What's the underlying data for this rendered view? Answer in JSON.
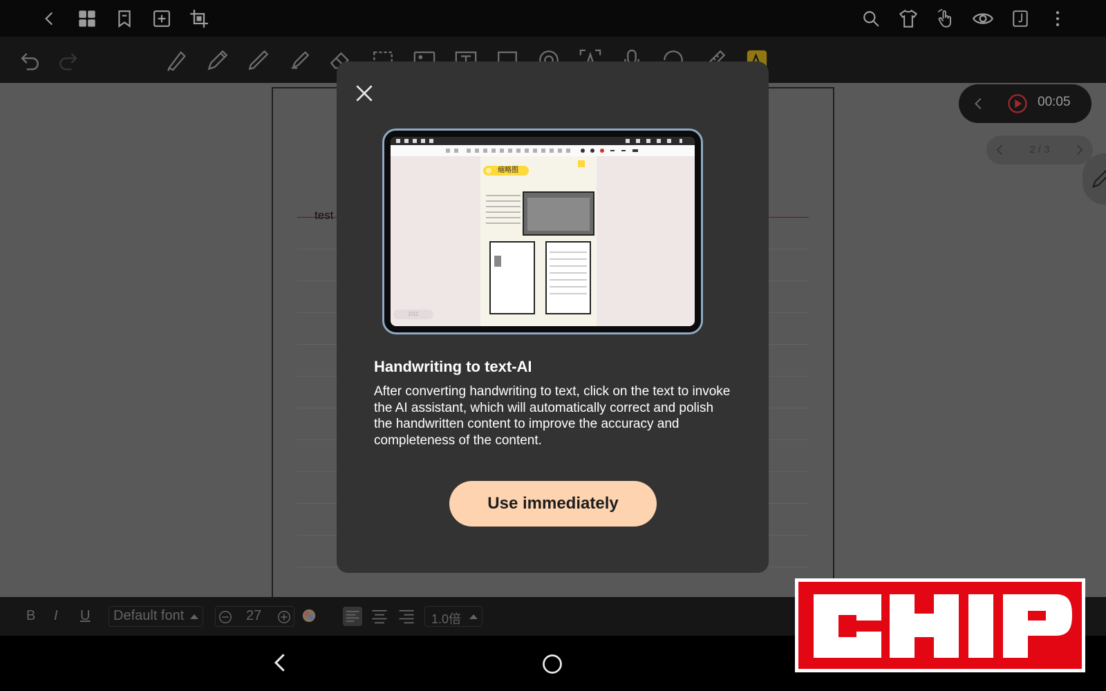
{
  "top_bar": {
    "left_icons": [
      "back-icon",
      "grid-icon",
      "bookmark-icon",
      "add-page-icon",
      "crop-icon"
    ],
    "right_icons": [
      "search-icon",
      "tshirt-icon",
      "gesture-icon",
      "eye-icon",
      "notebook-icon",
      "more-icon"
    ]
  },
  "toolbar": {
    "icons": [
      "undo-icon",
      "redo-icon",
      "fountain-pen-icon",
      "pencil-icon",
      "ballpoint-pen-icon",
      "highlighter-icon",
      "eraser-icon",
      "lasso-select-icon",
      "image-icon",
      "text-box-icon",
      "sticker-icon",
      "tape-icon",
      "ocr-icon",
      "microphone-icon",
      "shape-icon",
      "ruler-icon",
      "ai-icon"
    ]
  },
  "page": {
    "text": "test"
  },
  "recorder": {
    "time": "00:05"
  },
  "pager": {
    "label": "2 / 3"
  },
  "format_bar": {
    "bold": "B",
    "italic": "I",
    "underline": "U",
    "font": "Default font",
    "size": "27",
    "line_spacing": "1.0倍"
  },
  "dialog": {
    "title": "Handwriting to text-AI",
    "description": "After converting handwriting to text, click on the text to invoke the AI assistant, which will automatically correct and polish the handwritten content to improve the accuracy and completeness of the content.",
    "button": "Use immediately",
    "preview": {
      "badge": "缩略图",
      "page_indicator": "2/11"
    }
  },
  "watermark": {
    "text": "CHIP"
  },
  "colors": {
    "dialog_bg": "#333333",
    "button_bg": "#fdd3b0",
    "accent_red": "#e30613",
    "record_red": "#e0383e"
  }
}
